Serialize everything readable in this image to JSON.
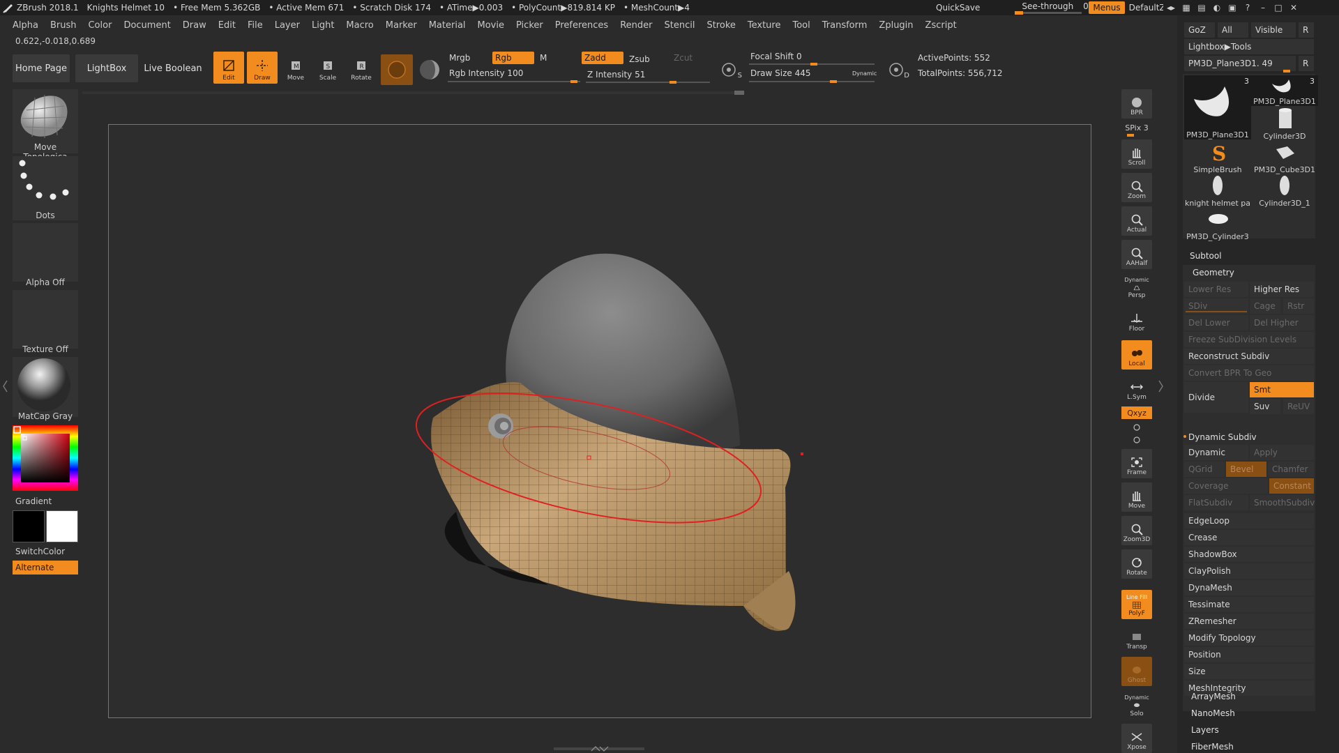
{
  "titlebar": {
    "app": "ZBrush 2018.1",
    "document": "Knights Helmet 10",
    "free_mem": "• Free Mem 5.362GB",
    "active_mem": "• Active Mem 671",
    "scratch": "• Scratch Disk 174",
    "atime": "• ATime▶0.003",
    "polycount": "• PolyCount▶819.814 KP",
    "meshcount": "• MeshCount▶4",
    "quicksave": "QuickSave",
    "see_through": "See-through",
    "see_through_value": "0",
    "menus": "Menus",
    "script": "DefaultZScript"
  },
  "menu": [
    "Alpha",
    "Brush",
    "Color",
    "Document",
    "Draw",
    "Edit",
    "File",
    "Layer",
    "Light",
    "Macro",
    "Marker",
    "Material",
    "Movie",
    "Picker",
    "Preferences",
    "Render",
    "Stencil",
    "Stroke",
    "Texture",
    "Tool",
    "Transform",
    "Zplugin",
    "Zscript"
  ],
  "coords": "0.622,-0.018,0.689",
  "toolbar": {
    "home": "Home Page",
    "lightbox": "LightBox",
    "live_boolean": "Live Boolean",
    "edit": "Edit",
    "draw": "Draw",
    "move": "Move",
    "scale": "Scale",
    "rotate": "Rotate",
    "mrgb": "Mrgb",
    "rgb": "Rgb",
    "m": "M",
    "zadd": "Zadd",
    "zsub": "Zsub",
    "zcut": "Zcut",
    "rgb_intensity": "Rgb Intensity 100",
    "z_intensity": "Z Intensity 51",
    "focal_shift": "Focal Shift 0",
    "draw_size": "Draw Size 445",
    "dynamic": "Dynamic",
    "active_points": "ActivePoints: 552",
    "total_points": "TotalPoints: 556,712",
    "s_label": "S",
    "d_label": "D"
  },
  "leftshelf": {
    "brush": "Move Topologica",
    "stroke": "Dots",
    "alpha": "Alpha Off",
    "texture": "Texture Off",
    "material": "MatCap Gray",
    "gradient": "Gradient",
    "switchcolor": "SwitchColor",
    "alternate": "Alternate"
  },
  "rightshelf": {
    "bpr": "BPR",
    "spix": "SPix 3",
    "scroll": "Scroll",
    "zoom": "Zoom",
    "actual": "Actual",
    "aahalf": "AAHalf",
    "persp_top": "Dynamic",
    "persp": "Persp",
    "floor": "Floor",
    "local": "Local",
    "lsym": "L.Sym",
    "xyz": "Qxyz",
    "frame": "Frame",
    "move": "Move",
    "zoom3d": "Zoom3D",
    "rotate": "Rotate",
    "polyf_top": "Line Fill",
    "polyf": "PolyF",
    "transp": "Transp",
    "ghost": "Ghost",
    "solo_top": "Dynamic",
    "solo": "Solo",
    "xpose": "Xpose"
  },
  "rightpanel": {
    "goz": "GoZ",
    "all": "All",
    "visible": "Visible",
    "r": "R",
    "lightbox_tools": "Lightbox▶Tools",
    "current_tool": "PM3D_Plane3D1. 49",
    "tools": [
      {
        "name": "PM3D_Plane3D1",
        "count": "3"
      },
      {
        "name": "PM3D_Plane3D1",
        "count": "3"
      },
      {
        "name": "PM3D_Plane3D1",
        "count": ""
      },
      {
        "name": "Cylinder3D",
        "count": ""
      },
      {
        "name": "SimpleBrush",
        "count": ""
      },
      {
        "name": "PM3D_Cube3D1",
        "count": ""
      },
      {
        "name": "knight helmet pa",
        "count": ""
      },
      {
        "name": "Cylinder3D_1",
        "count": ""
      },
      {
        "name": "PM3D_Cylinder3",
        "count": ""
      }
    ],
    "subtool": "Subtool",
    "geometry": "Geometry",
    "lower_res": "Lower Res",
    "higher_res": "Higher Res",
    "sdiv": "SDiv",
    "cage": "Cage",
    "rstr": "Rstr",
    "del_lower": "Del Lower",
    "del_higher": "Del Higher",
    "freeze": "Freeze SubDivision Levels",
    "reconstruct": "Reconstruct Subdiv",
    "convert_bpr": "Convert BPR To Geo",
    "divide": "Divide",
    "smt": "Smt",
    "suv": "Suv",
    "reuv": "ReUV",
    "dynamic_subdiv": "Dynamic Subdiv",
    "dynamic": "Dynamic",
    "apply": "Apply",
    "qgrid": "QGrid",
    "bevel": "Bevel",
    "chamfer": "Chamfer",
    "coverage": "Coverage",
    "constant": "Constant",
    "flatsubdiv": "FlatSubdiv",
    "smoothsubdiv": "SmoothSubdiv",
    "sections": [
      "EdgeLoop",
      "Crease",
      "ShadowBox",
      "ClayPolish",
      "DynaMesh",
      "Tessimate",
      "ZRemesher",
      "Modify Topology",
      "Position",
      "Size",
      "MeshIntegrity"
    ],
    "lower_sections": [
      "ArrayMesh",
      "NanoMesh",
      "Layers",
      "FiberMesh"
    ]
  },
  "colors": {
    "accent": "#f28c1e",
    "background": "#2b2b2b",
    "panel": "#262626"
  }
}
